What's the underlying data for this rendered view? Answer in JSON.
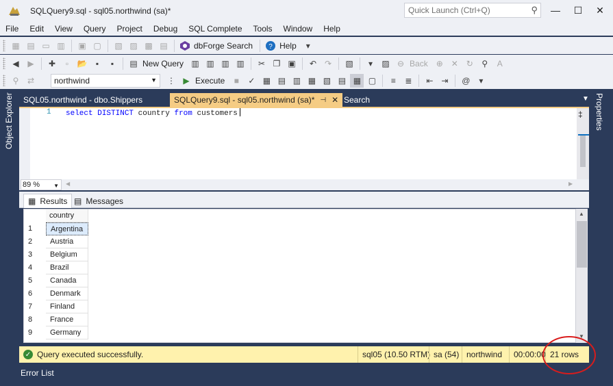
{
  "window": {
    "title": "SQLQuery9.sql - sql05.northwind (sa)*",
    "quick_launch_placeholder": "Quick Launch (Ctrl+Q)",
    "minimize": "—",
    "maximize": "☐",
    "close": "✕"
  },
  "menu": [
    "File",
    "Edit",
    "View",
    "Query",
    "Project",
    "Debug",
    "SQL Complete",
    "Tools",
    "Window",
    "Help"
  ],
  "toolbar": {
    "dbforge_search": "dbForge Search",
    "help": "Help",
    "new_query": "New Query",
    "back": "Back",
    "execute": "Execute",
    "database": "northwind"
  },
  "side": {
    "object_explorer": "Object Explorer",
    "properties": "Properties"
  },
  "tabs": [
    {
      "label": "SQL05.northwind - dbo.Shippers",
      "active": false
    },
    {
      "label": "SQLQuery9.sql - sql05.northwind (sa)*",
      "active": true
    },
    {
      "label": "Search",
      "active": false
    }
  ],
  "editor": {
    "line_number": "1",
    "kw_select": "select",
    "kw_distinct": "DISTINCT",
    "col": "country",
    "kw_from": "from",
    "table": "customers"
  },
  "zoom": "89 %",
  "results": {
    "tab_results": "Results",
    "tab_messages": "Messages",
    "column": "country",
    "rows": [
      {
        "n": "1",
        "country": "Argentina"
      },
      {
        "n": "2",
        "country": "Austria"
      },
      {
        "n": "3",
        "country": "Belgium"
      },
      {
        "n": "4",
        "country": "Brazil"
      },
      {
        "n": "5",
        "country": "Canada"
      },
      {
        "n": "6",
        "country": "Denmark"
      },
      {
        "n": "7",
        "country": "Finland"
      },
      {
        "n": "8",
        "country": "France"
      },
      {
        "n": "9",
        "country": "Germany"
      }
    ]
  },
  "status": {
    "message": "Query executed successfully.",
    "server": "sql05 (10.50 RTM)",
    "user": "sa (54)",
    "database": "northwind",
    "elapsed": "00:00:00",
    "rows": "21 rows"
  },
  "bottom": {
    "error_list": "Error List"
  },
  "colors": {
    "accent_tab": "#f5cc84",
    "status_bar": "#fff2ad",
    "frame": "#2b3b5a",
    "annotation_circle": "#d91c1c"
  }
}
